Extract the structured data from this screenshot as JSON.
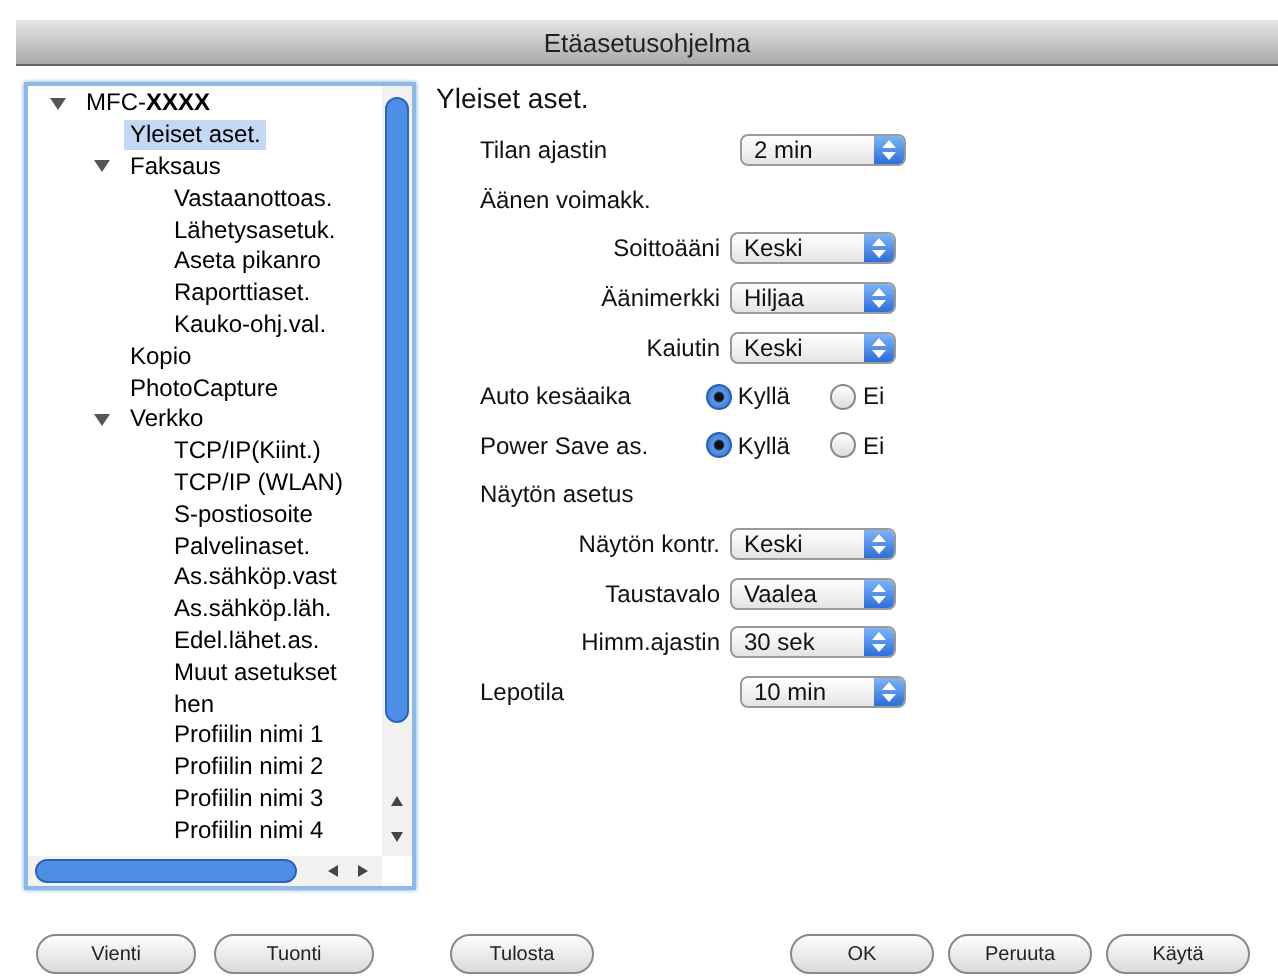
{
  "window": {
    "title": "Etäasetusohjelma"
  },
  "tree": [
    {
      "label": "MFC-**XXXX**",
      "expanded": true,
      "selected": false,
      "children": [
        {
          "label": "Yleiset aset.",
          "selected": true
        },
        {
          "label": "Faksaus",
          "expanded": true,
          "selected": false,
          "children": [
            {
              "label": "Vastaanottoas.",
              "selected": false
            },
            {
              "label": "Lähetysasetuk.",
              "selected": false
            },
            {
              "label": "Aseta pikanro",
              "selected": false
            },
            {
              "label": "Raporttiaset.",
              "selected": false
            },
            {
              "label": "Kauko-ohj.val.",
              "selected": false
            }
          ]
        },
        {
          "label": "Kopio",
          "selected": false
        },
        {
          "label": "PhotoCapture",
          "selected": false
        },
        {
          "label": "Verkko",
          "expanded": true,
          "selected": false,
          "children": [
            {
              "label": "TCP/IP(Kiint.)",
              "selected": false
            },
            {
              "label": "TCP/IP (WLAN)",
              "selected": false
            },
            {
              "label": "S-postiosoite",
              "selected": false
            },
            {
              "label": "Palvelinaset.",
              "selected": false
            },
            {
              "label": "As.sähköp.vast",
              "selected": false
            },
            {
              "label": "As.sähköp.läh.",
              "selected": false
            },
            {
              "label": "Edel.lähet.as.",
              "selected": false
            },
            {
              "label": "Muut asetukset",
              "selected": false
            },
            {
              "label": "hen",
              "selected": false
            },
            {
              "label": "Profiilin nimi 1",
              "selected": false
            },
            {
              "label": "Profiilin nimi 2",
              "selected": false
            },
            {
              "label": "Profiilin nimi 3",
              "selected": false
            },
            {
              "label": "Profiilin nimi 4",
              "selected": false
            }
          ]
        }
      ]
    }
  ],
  "panel": {
    "title": "Yleiset aset.",
    "rows": [
      {
        "kind": "select",
        "label": "Tilan ajastin",
        "value": "2 min"
      },
      {
        "kind": "section",
        "label": "Äänen voimakk.",
        "children": [
          {
            "kind": "select",
            "label": "Soittoääni",
            "value": "Keski"
          },
          {
            "kind": "select",
            "label": "Äänimerkki",
            "value": "Hiljaa"
          },
          {
            "kind": "select",
            "label": "Kaiutin",
            "value": "Keski"
          }
        ]
      },
      {
        "kind": "radio",
        "label": "Auto kesäaika",
        "options": [
          {
            "label": "Kyllä",
            "selected": true
          },
          {
            "label": "Ei",
            "selected": false
          }
        ]
      },
      {
        "kind": "radio",
        "label": "Power Save as.",
        "options": [
          {
            "label": "Kyllä",
            "selected": true
          },
          {
            "label": "Ei",
            "selected": false
          }
        ]
      },
      {
        "kind": "section",
        "label": "Näytön asetus",
        "children": [
          {
            "kind": "select",
            "label": "Näytön kontr.",
            "value": "Keski"
          },
          {
            "kind": "select",
            "label": "Taustavalo",
            "value": "Vaalea"
          },
          {
            "kind": "select",
            "label": "Himm.ajastin",
            "value": "30 sek"
          }
        ]
      },
      {
        "kind": "select",
        "label": "Lepotila",
        "value": "10 min"
      }
    ]
  },
  "buttons_left": [
    "Vienti",
    "Tuonti",
    "Tulosta"
  ],
  "buttons_right": [
    "OK",
    "Peruuta",
    "Käytä"
  ]
}
